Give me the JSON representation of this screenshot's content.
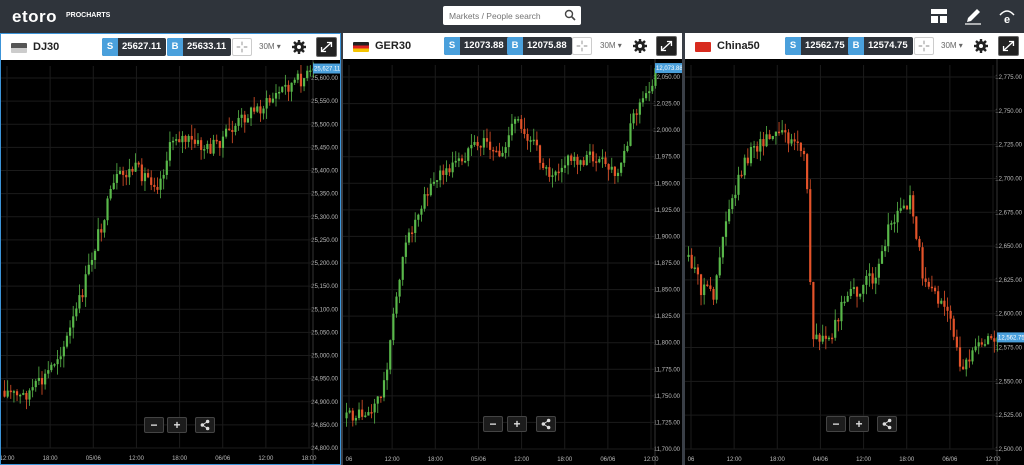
{
  "app": {
    "logo": "etoro",
    "logo_sub": "PROCHARTS"
  },
  "search": {
    "placeholder": "Markets / People search"
  },
  "icons": {
    "layout": "layout-icon",
    "edit": "pencil-icon",
    "brand": "etoro-e-icon"
  },
  "colors": {
    "up": "#59b84a",
    "down": "#e4532a",
    "accent": "#3c94d8",
    "price_label": "#4aa0dc"
  },
  "panels": [
    {
      "name": "DJ30",
      "sell_tag": "S",
      "sell": "25627.11",
      "buy_tag": "B",
      "buy": "25633.11",
      "timeframe": "30M",
      "active": true,
      "price_label": "25,627.11",
      "y_ticks": [
        "25,600.00",
        "25,550.00",
        "25,500.00",
        "25,450.00",
        "25,400.00",
        "25,350.00",
        "25,300.00",
        "25,250.00",
        "25,200.00",
        "25,150.00",
        "25,100.00",
        "25,050.00",
        "25,000.00",
        "24,950.00",
        "24,900.00",
        "24,850.00",
        "24,800.00"
      ],
      "x_ticks": [
        "12:00",
        "18:00",
        "05/06",
        "12:00",
        "18:00",
        "06/06",
        "12:00",
        "18:00"
      ],
      "buttons": {
        "zoom_out": "−",
        "zoom_in": "+"
      }
    },
    {
      "name": "GER30",
      "sell_tag": "S",
      "sell": "12073.88",
      "buy_tag": "B",
      "buy": "12075.88",
      "timeframe": "30M",
      "active": false,
      "price_label": "12,073.88",
      "y_ticks": [
        "12,050.00",
        "12,025.00",
        "12,000.00",
        "11,975.00",
        "11,950.00",
        "11,925.00",
        "11,900.00",
        "11,875.00",
        "11,850.00",
        "11,825.00",
        "11,800.00",
        "11,775.00",
        "11,750.00",
        "11,725.00",
        "11,700.00"
      ],
      "x_ticks": [
        "06",
        "12:00",
        "18:00",
        "05/06",
        "12:00",
        "18:00",
        "06/06",
        "12:00"
      ],
      "buttons": {
        "zoom_out": "−",
        "zoom_in": "+"
      }
    },
    {
      "name": "China50",
      "sell_tag": "S",
      "sell": "12562.75",
      "buy_tag": "B",
      "buy": "12574.75",
      "timeframe": "30M",
      "active": false,
      "price_label": "12,562.75",
      "y_ticks": [
        "12,775.00",
        "12,750.00",
        "12,725.00",
        "12,700.00",
        "12,675.00",
        "12,650.00",
        "12,625.00",
        "12,600.00",
        "12,575.00",
        "12,550.00",
        "12,525.00",
        "12,500.00"
      ],
      "x_ticks": [
        "06",
        "12:00",
        "18:00",
        "04/06",
        "12:00",
        "18:00",
        "06/06",
        "12:00"
      ],
      "buttons": {
        "zoom_out": "−",
        "zoom_in": "+"
      }
    }
  ]
}
